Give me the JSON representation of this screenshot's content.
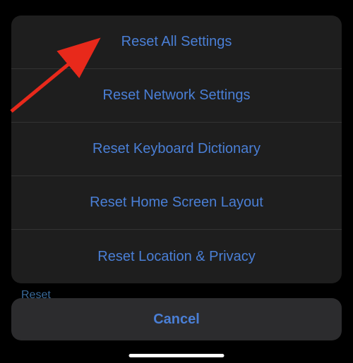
{
  "actions": {
    "reset_all": "Reset All Settings",
    "reset_network": "Reset Network Settings",
    "reset_keyboard": "Reset Keyboard Dictionary",
    "reset_home": "Reset Home Screen Layout",
    "reset_location": "Reset Location & Privacy"
  },
  "cancel_label": "Cancel",
  "background_hint": "Reset"
}
